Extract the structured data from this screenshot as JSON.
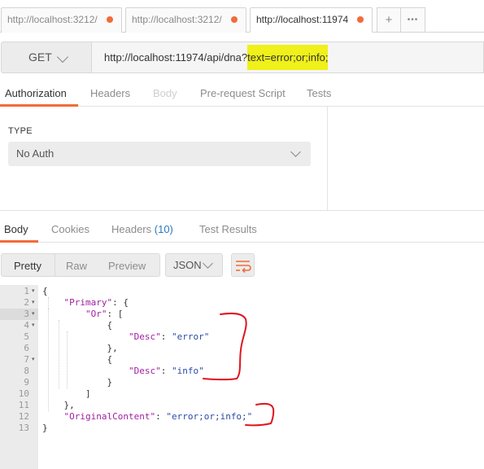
{
  "tabs": [
    {
      "title": "http://localhost:3212/",
      "modified": true
    },
    {
      "title": "http://localhost:3212/",
      "modified": true
    },
    {
      "title": "http://localhost:11974",
      "modified": true
    }
  ],
  "tab_actions": {
    "add": "+",
    "more": "•••"
  },
  "request": {
    "method": "GET",
    "url_base": "http://localhost:11974/api/dna?",
    "url_query": "text=error;or;info;"
  },
  "request_tabs": [
    "Authorization",
    "Headers",
    "Body",
    "Pre-request Script",
    "Tests"
  ],
  "auth": {
    "type_label": "TYPE",
    "type_value": "No Auth"
  },
  "response_tabs": {
    "body": "Body",
    "cookies": "Cookies",
    "headers": "Headers",
    "headers_count": "(10)",
    "test_results": "Test Results"
  },
  "view_modes": [
    "Pretty",
    "Raw",
    "Preview"
  ],
  "format": "JSON",
  "editor": {
    "line_numbers": [
      "1",
      "2",
      "3",
      "4",
      "5",
      "6",
      "7",
      "8",
      "9",
      "10",
      "11",
      "12",
      "13"
    ],
    "lines": [
      [
        [
          "pun",
          "{"
        ]
      ],
      [
        [
          "pun",
          "    "
        ],
        [
          "key",
          "\"Primary\""
        ],
        [
          "pun",
          ": {"
        ]
      ],
      [
        [
          "pun",
          "        "
        ],
        [
          "key",
          "\"Or\""
        ],
        [
          "pun",
          ": ["
        ]
      ],
      [
        [
          "pun",
          "            {"
        ]
      ],
      [
        [
          "pun",
          "                "
        ],
        [
          "key",
          "\"Desc\""
        ],
        [
          "pun",
          ": "
        ],
        [
          "str",
          "\"error\""
        ]
      ],
      [
        [
          "pun",
          "            },"
        ]
      ],
      [
        [
          "pun",
          "            {"
        ]
      ],
      [
        [
          "pun",
          "                "
        ],
        [
          "key",
          "\"Desc\""
        ],
        [
          "pun",
          ": "
        ],
        [
          "str",
          "\"info\""
        ]
      ],
      [
        [
          "pun",
          "            }"
        ]
      ],
      [
        [
          "pun",
          "        ]"
        ]
      ],
      [
        [
          "pun",
          "    },"
        ]
      ],
      [
        [
          "pun",
          "    "
        ],
        [
          "key",
          "\"OriginalContent\""
        ],
        [
          "pun",
          ": "
        ],
        [
          "str",
          "\"error;or;info;\""
        ]
      ],
      [
        [
          "pun",
          "}"
        ]
      ]
    ],
    "fold_lines": [
      1,
      2,
      3,
      4,
      7
    ]
  },
  "colors": {
    "accent": "#f26b3a",
    "highlight": "#f0f01a",
    "annotation": "#e0141e",
    "link": "#2a7ac1"
  }
}
